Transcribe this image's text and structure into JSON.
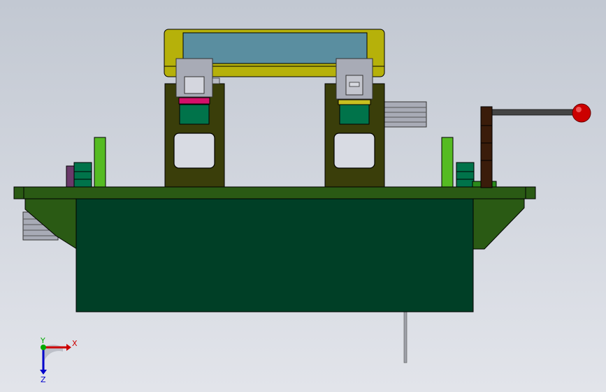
{
  "view": {
    "background": [
      "#c2c8d2",
      "#e2e4ea"
    ]
  },
  "colors": {
    "base_plate": "#003f26",
    "fixture_green": "#2a5a14",
    "frame_olive": "#3a3e0a",
    "cover_yellow": "#b6b10a",
    "glass": "#5a8ea0",
    "block_green": "#00734a",
    "light_green": "#55bb22",
    "magenta": "#d4106a",
    "silver": "#a8abb6",
    "handle_brown": "#3a1c0a",
    "knob_red": "#cc0000",
    "axis_red": "#cc0000",
    "axis_blue": "#0000cc",
    "axis_green": "#00aa00"
  },
  "triad": {
    "x_label": "X",
    "y_label": "Y",
    "z_label": "Z"
  }
}
